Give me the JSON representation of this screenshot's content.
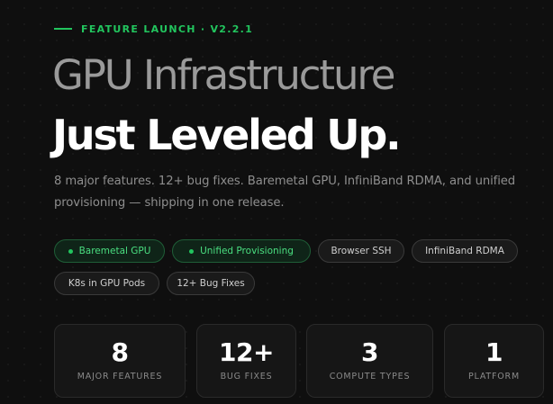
{
  "header": {
    "eyebrow": "FEATURE LAUNCH · V2.2.1",
    "title_line1": "GPU Infrastructure",
    "title_line2": "Just Leveled Up.",
    "subtitle": "8 major features. 12+ bug fixes. Baremetal GPU, InfiniBand RDMA, and unified provisioning — shipping in one release."
  },
  "tags": [
    {
      "label": "Baremetal GPU",
      "active": true
    },
    {
      "label": "Unified Provisioning",
      "active": true
    },
    {
      "label": "Browser SSH",
      "active": false
    },
    {
      "label": "InfiniBand RDMA",
      "active": false
    },
    {
      "label": "K8s in GPU Pods",
      "active": false
    },
    {
      "label": "12+ Bug Fixes",
      "active": false
    }
  ],
  "stats": [
    {
      "value": "8",
      "label": "MAJOR FEATURES"
    },
    {
      "value": "12+",
      "label": "BUG FIXES"
    },
    {
      "value": "3",
      "label": "COMPUTE TYPES"
    },
    {
      "value": "1",
      "label": "PLATFORM"
    }
  ],
  "colors": {
    "accent": "#22c55e",
    "background": "#0f0f0f"
  }
}
